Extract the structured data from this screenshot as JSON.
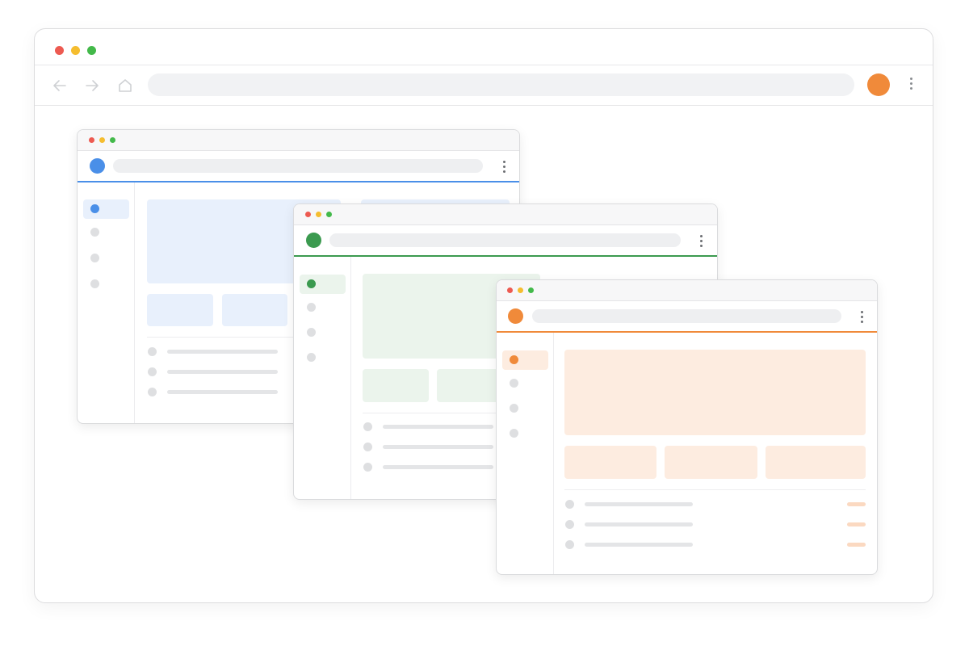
{
  "colors": {
    "traffic_red": "#ed5a51",
    "traffic_yellow": "#f5bd2f",
    "traffic_green": "#43b94a",
    "blue_accent": "#4a8fe8",
    "blue_tint": "#e8f0fc",
    "green_accent": "#3b9a4f",
    "green_tint": "#ebf4ec",
    "orange_accent": "#f08a3a",
    "orange_tint": "#fdece0",
    "neutral_dot": "#dedfe1"
  },
  "icons": {
    "back": "arrow-left-icon",
    "forward": "arrow-right-icon",
    "home": "home-icon",
    "menu": "kebab-menu-icon",
    "avatar": "avatar-circle"
  },
  "outer_browser": {
    "avatar_color": "#f08a3a"
  },
  "windows": [
    {
      "name": "blue",
      "accent": "#4a8fe8",
      "tint": "#e8f0fc"
    },
    {
      "name": "green",
      "accent": "#3b9a4f",
      "tint": "#ebf4ec"
    },
    {
      "name": "orange",
      "accent": "#f08a3a",
      "tint": "#fdece0"
    }
  ]
}
